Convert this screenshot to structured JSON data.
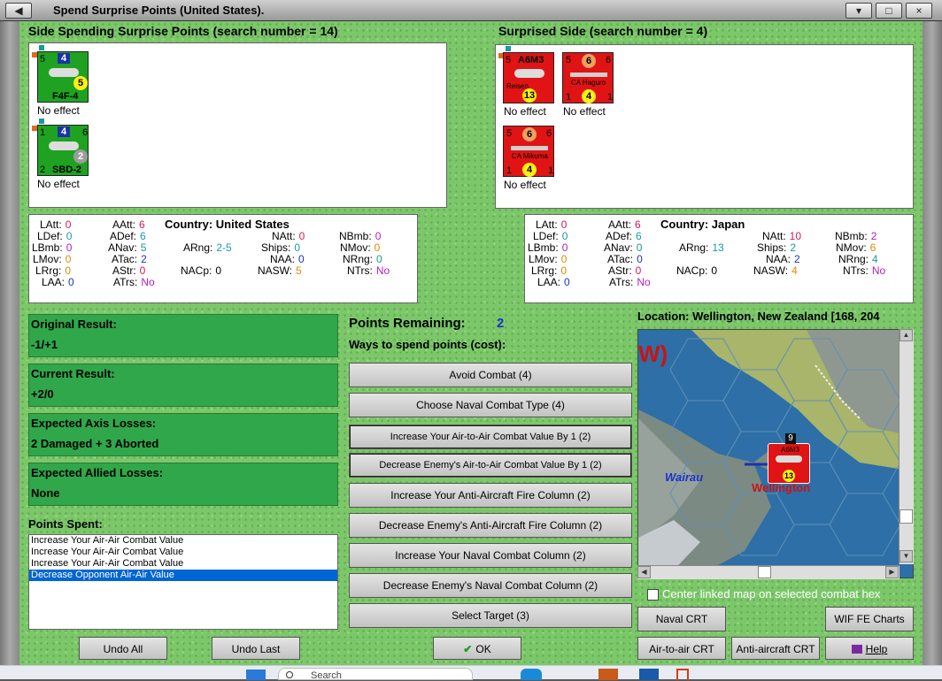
{
  "window": {
    "title": "Spend Surprise Points (United States)."
  },
  "left_panel": {
    "header": "Side Spending Surprise Points (search number = 14)",
    "units": [
      {
        "name": "F4F-4",
        "top_left": "5",
        "top_mid": "4",
        "bottom_val": "5",
        "effect": "No effect"
      },
      {
        "name": "SBD-2",
        "top_left": "1",
        "top_mid": "4",
        "top_right": "6",
        "bottom_left": "2",
        "bottom_val": "2",
        "effect": "No effect"
      }
    ]
  },
  "right_panel": {
    "header": "Surprised Side (search number = 4)",
    "units": [
      {
        "name": "A6M3",
        "sub": "Reisen",
        "top_left": "5",
        "bottom_val": "13",
        "effect": "No effect"
      },
      {
        "name": "CA Haguro",
        "top_left": "5",
        "top_mid": "6",
        "top_right": "6",
        "bottom_left": "1",
        "bottom_mid": "4",
        "bottom_right": "1",
        "effect": "No effect"
      },
      {
        "name": "CA Mikuma",
        "top_left": "5",
        "top_mid": "6",
        "top_right": "6",
        "bottom_left": "1",
        "bottom_mid": "4",
        "bottom_right": "1",
        "effect": "No effect"
      }
    ]
  },
  "stats_us": {
    "country_label": "Country: United States",
    "latt": {
      "label": "LAtt:",
      "value": "0"
    },
    "ldef": {
      "label": "LDef:",
      "value": "0"
    },
    "lbmb": {
      "label": "LBmb:",
      "value": "0"
    },
    "lmov": {
      "label": "LMov:",
      "value": "0"
    },
    "lrrg": {
      "label": "LRrg:",
      "value": "0"
    },
    "laa": {
      "label": "LAA:",
      "value": "0"
    },
    "aatt": {
      "label": "AAtt:",
      "value": "6"
    },
    "adef": {
      "label": "ADef:",
      "value": "6"
    },
    "anav": {
      "label": "ANav:",
      "value": "5"
    },
    "atac": {
      "label": "ATac:",
      "value": "2"
    },
    "astr": {
      "label": "AStr:",
      "value": "0"
    },
    "atrs": {
      "label": "ATrs:",
      "value": "No"
    },
    "arng": {
      "label": "ARng:",
      "value": "2-5"
    },
    "nacp": {
      "label": "NACp:",
      "value": "0"
    },
    "natt": {
      "label": "NAtt:",
      "value": "0"
    },
    "ships": {
      "label": "Ships:",
      "value": "0"
    },
    "naa": {
      "label": "NAA:",
      "value": "0"
    },
    "nasw": {
      "label": "NASW:",
      "value": "5"
    },
    "nbmb": {
      "label": "NBmb:",
      "value": "0"
    },
    "nmov": {
      "label": "NMov:",
      "value": "0"
    },
    "nrng": {
      "label": "NRng:",
      "value": "0"
    },
    "ntrs": {
      "label": "NTrs:",
      "value": "No"
    }
  },
  "stats_jp": {
    "country_label": "Country: Japan",
    "latt": {
      "label": "LAtt:",
      "value": "0"
    },
    "ldef": {
      "label": "LDef:",
      "value": "0"
    },
    "lbmb": {
      "label": "LBmb:",
      "value": "0"
    },
    "lmov": {
      "label": "LMov:",
      "value": "0"
    },
    "lrrg": {
      "label": "LRrg:",
      "value": "0"
    },
    "laa": {
      "label": "LAA:",
      "value": "0"
    },
    "aatt": {
      "label": "AAtt:",
      "value": "6"
    },
    "adef": {
      "label": "ADef:",
      "value": "6"
    },
    "anav": {
      "label": "ANav:",
      "value": "0"
    },
    "atac": {
      "label": "ATac:",
      "value": "0"
    },
    "astr": {
      "label": "AStr:",
      "value": "0"
    },
    "atrs": {
      "label": "ATrs:",
      "value": "No"
    },
    "arng": {
      "label": "ARng:",
      "value": "13"
    },
    "nacp": {
      "label": "NACp:",
      "value": "0"
    },
    "natt": {
      "label": "NAtt:",
      "value": "10"
    },
    "ships": {
      "label": "Ships:",
      "value": "2"
    },
    "naa": {
      "label": "NAA:",
      "value": "2"
    },
    "nasw": {
      "label": "NASW:",
      "value": "4"
    },
    "nbmb": {
      "label": "NBmb:",
      "value": "2"
    },
    "nmov": {
      "label": "NMov:",
      "value": "6"
    },
    "nrng": {
      "label": "NRng:",
      "value": "4"
    },
    "ntrs": {
      "label": "NTrs:",
      "value": "No"
    }
  },
  "results": {
    "original": {
      "label": "Original Result:",
      "value": "-1/+1"
    },
    "current": {
      "label": "Current Result:",
      "value": "+2/0"
    },
    "axis": {
      "label": "Expected Axis Losses:",
      "value": "2 Damaged + 3 Aborted"
    },
    "allied": {
      "label": "Expected Allied Losses:",
      "value": "None"
    }
  },
  "points": {
    "remaining_label": "Points Remaining:",
    "remaining_value": "2",
    "ways_label": "Ways to spend points (cost):",
    "spent_label": "Points Spent:",
    "spent_items": [
      "Increase Your Air-Air Combat Value",
      "Increase Your Air-Air Combat Value",
      "Increase Your Air-Air Combat Value",
      "Decrease Opponent Air-Air Value"
    ]
  },
  "options": [
    "Avoid Combat (4)",
    "Choose Naval Combat Type (4)",
    "Increase Your Air-to-Air Combat Value By 1 (2)",
    "Decrease Enemy's Air-to-Air Combat Value By 1 (2)",
    "Increase Your Anti-Aircraft Fire Column (2)",
    "Decrease Enemy's Anti-Aircraft Fire Column (2)",
    "Increase Your Naval Combat Column (2)",
    "Decrease Enemy's Naval Combat Column (2)",
    "Select Target (3)"
  ],
  "map": {
    "location": "Location: Wellington, New Zealand [168, 204",
    "big_label": "W)",
    "label_wairau": "Wairau",
    "label_wellington": "Wellington",
    "stack_count": "9",
    "unit_name": "A6M3",
    "unit_val": "13",
    "center_label": "Center linked map on selected combat hex"
  },
  "buttons": {
    "undo_all": "Undo All",
    "undo_last": "Undo Last",
    "ok": "OK",
    "naval_crt": "Naval CRT",
    "wif_fe": "WIF FE Charts",
    "air_crt": "Air-to-air CRT",
    "aa_crt": "Anti-aircraft CRT",
    "help": "Help"
  },
  "taskbar": {
    "search": "Search"
  },
  "colors": {
    "zero": "#e0145c",
    "cyan": "#1a9aa0",
    "blue": "#1a33c8",
    "orange": "#e08a00",
    "purple": "#b020c0",
    "red": "#e01414",
    "green_result": "#30a74a"
  }
}
